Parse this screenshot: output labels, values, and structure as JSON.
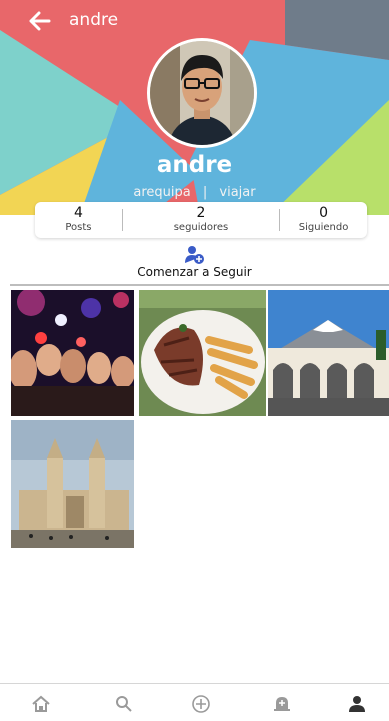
{
  "header": {
    "title": "andre",
    "back_icon": "arrow-left-icon"
  },
  "profile": {
    "name": "andre",
    "tags": [
      "arequipa",
      "viajar"
    ],
    "tag_separator": "|"
  },
  "stats": [
    {
      "value": "4",
      "label": "Posts"
    },
    {
      "value": "2",
      "label": "seguidores"
    },
    {
      "value": "0",
      "label": "Siguiendo"
    }
  ],
  "follow_button": {
    "label": "Comenzar a Seguir",
    "icon": "add-user-icon",
    "color": "#3a5bc7"
  },
  "posts": [
    {
      "subject": "party-photo"
    },
    {
      "subject": "food-photo"
    },
    {
      "subject": "volcano-arches-photo"
    },
    {
      "subject": "cathedral-photo"
    }
  ],
  "bottom_nav": [
    {
      "icon": "home-icon",
      "active": false
    },
    {
      "icon": "search-icon",
      "active": false
    },
    {
      "icon": "add-circle-icon",
      "active": false
    },
    {
      "icon": "notification-bell-icon",
      "active": false
    },
    {
      "icon": "profile-icon",
      "active": true
    }
  ],
  "colors": {
    "header_red": "#e8676a",
    "header_teal": "#7ed1cb",
    "header_blue": "#5fb4dc",
    "header_yellow": "#f2d554",
    "header_gray": "#6f7c8a",
    "header_green": "#b8e06a",
    "accent_blue": "#3a5bc7",
    "nav_gray": "#9a9a9a",
    "nav_active": "#333333"
  }
}
